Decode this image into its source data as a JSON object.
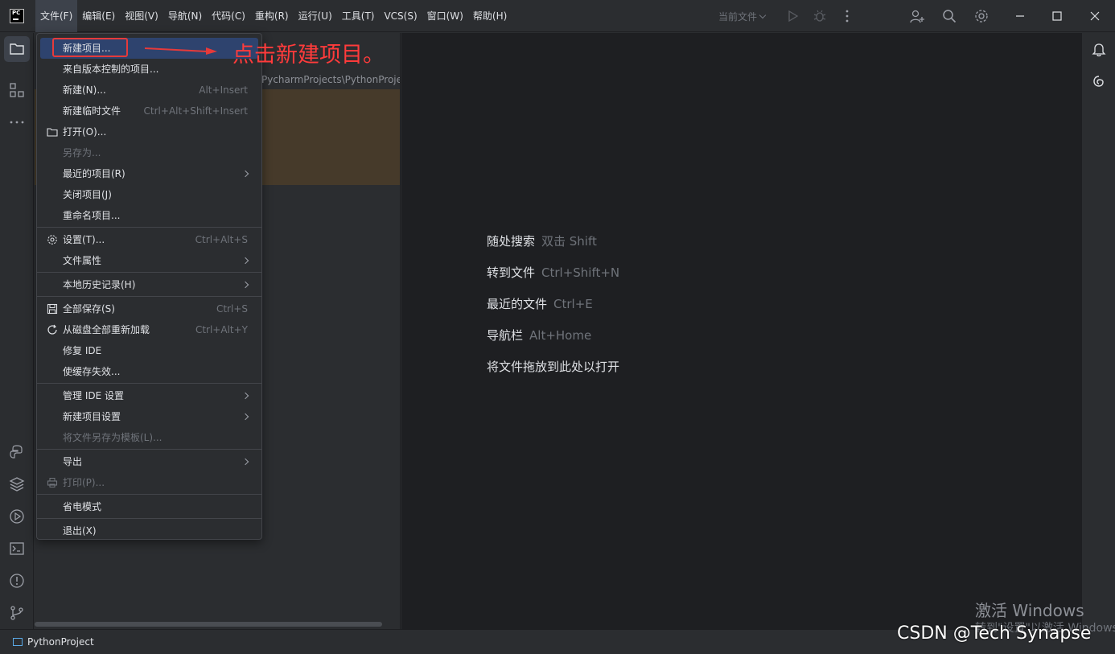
{
  "menubar": {
    "items": [
      {
        "label": "文件(F)"
      },
      {
        "label": "编辑(E)"
      },
      {
        "label": "视图(V)"
      },
      {
        "label": "导航(N)"
      },
      {
        "label": "代码(C)"
      },
      {
        "label": "重构(R)"
      },
      {
        "label": "运行(U)"
      },
      {
        "label": "工具(T)"
      },
      {
        "label": "VCS(S)"
      },
      {
        "label": "窗口(W)"
      },
      {
        "label": "帮助(H)"
      }
    ]
  },
  "toolbar": {
    "run_config": "当前文件"
  },
  "project_panel": {
    "path": "PycharmProjects\\PythonProje"
  },
  "file_menu": {
    "items": [
      {
        "label": "新建项目...",
        "shortcut": "",
        "state": "selected"
      },
      {
        "label": "来自版本控制的项目...",
        "shortcut": ""
      },
      {
        "label": "新建(N)...",
        "shortcut": "Alt+Insert"
      },
      {
        "label": "新建临时文件",
        "shortcut": "Ctrl+Alt+Shift+Insert"
      },
      {
        "label": "打开(O)...",
        "shortcut": "",
        "icon": "folder-icon"
      },
      {
        "label": "另存为...",
        "shortcut": "",
        "state": "disabled"
      },
      {
        "label": "最近的项目(R)",
        "shortcut": "",
        "submenu": true
      },
      {
        "label": "关闭项目(J)",
        "shortcut": ""
      },
      {
        "label": "重命名项目...",
        "shortcut": ""
      },
      {
        "label": "设置(T)...",
        "shortcut": "Ctrl+Alt+S",
        "icon": "gear-icon"
      },
      {
        "label": "文件属性",
        "shortcut": "",
        "submenu": true
      },
      {
        "label": "本地历史记录(H)",
        "shortcut": "",
        "submenu": true
      },
      {
        "label": "全部保存(S)",
        "shortcut": "Ctrl+S",
        "icon": "save-icon"
      },
      {
        "label": "从磁盘全部重新加载",
        "shortcut": "Ctrl+Alt+Y",
        "icon": "reload-icon"
      },
      {
        "label": "修复 IDE",
        "shortcut": ""
      },
      {
        "label": "使缓存失效...",
        "shortcut": ""
      },
      {
        "label": "管理 IDE 设置",
        "shortcut": "",
        "submenu": true
      },
      {
        "label": "新建项目设置",
        "shortcut": "",
        "submenu": true
      },
      {
        "label": "将文件另存为模板(L)...",
        "shortcut": "",
        "state": "disabled"
      },
      {
        "label": "导出",
        "shortcut": "",
        "submenu": true
      },
      {
        "label": "打印(P)...",
        "shortcut": "",
        "state": "disabled",
        "icon": "print-icon"
      },
      {
        "label": "省电模式",
        "shortcut": ""
      },
      {
        "label": "退出(X)",
        "shortcut": ""
      }
    ]
  },
  "annotation": {
    "text": "点击新建项目。",
    "color": "#ff3b3b"
  },
  "editor_hints": [
    {
      "label": "随处搜索",
      "shortcut": "双击 Shift"
    },
    {
      "label": "转到文件",
      "shortcut": "Ctrl+Shift+N"
    },
    {
      "label": "最近的文件",
      "shortcut": "Ctrl+E"
    },
    {
      "label": "导航栏",
      "shortcut": "Alt+Home"
    },
    {
      "label": "将文件拖放到此处以打开",
      "shortcut": ""
    }
  ],
  "statusbar": {
    "project": "PythonProject"
  },
  "watermark": {
    "line1": "激活 Windows",
    "line2": "转到\"设置\"以激活 Windows。",
    "csdn": "CSDN @Tech Synapse"
  },
  "colors": {
    "accent": "#2e436e",
    "background": "#2b2d30",
    "editor": "#1e1f22"
  }
}
